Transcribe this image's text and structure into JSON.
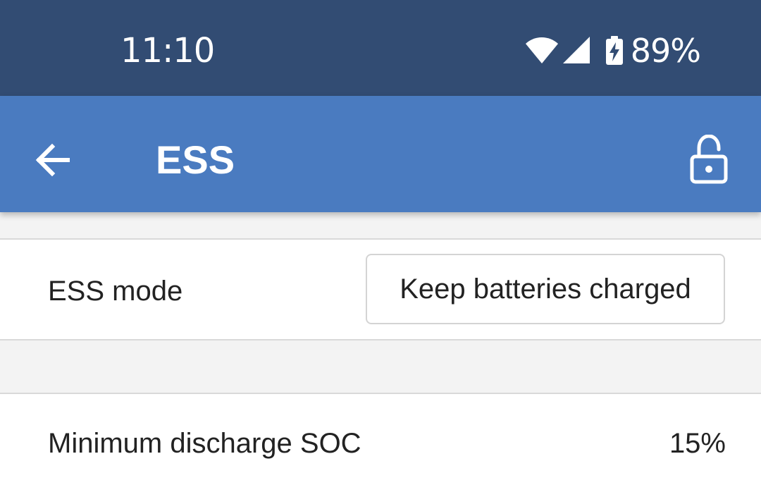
{
  "status_bar": {
    "time": "11:10",
    "battery_percent": "89%",
    "icons": [
      "wifi-icon",
      "signal-icon",
      "battery-charging-icon"
    ],
    "background": "#324c73"
  },
  "app_bar": {
    "title": "ESS",
    "back_icon": "arrow-back-icon",
    "lock_icon": "lock-open-icon",
    "background": "#4a7bc0"
  },
  "settings": {
    "ess_mode": {
      "label": "ESS mode",
      "value": "Keep batteries charged"
    },
    "min_discharge_soc": {
      "label": "Minimum discharge SOC",
      "value": "15%"
    }
  }
}
